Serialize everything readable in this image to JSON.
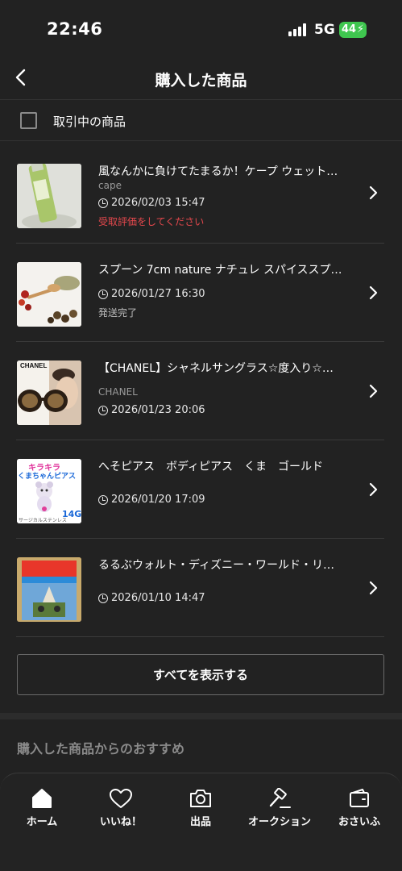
{
  "status": {
    "time": "22:46",
    "network": "5G",
    "battery": "44"
  },
  "header": {
    "title": "購入した商品"
  },
  "filter": {
    "label": "取引中の商品"
  },
  "items": [
    {
      "title": "風なんかに負けてたまるか！ケープ ウェット…",
      "brand": "cape",
      "date": "2026/02/03 15:47",
      "status": "受取評価をしてください",
      "status_color": "#e5484d"
    },
    {
      "title": "スプーン 7cm nature ナチュレ スパイススプ…",
      "brand": "",
      "date": "2026/01/27 16:30",
      "status": "発送完了",
      "status_color": "#bdbdbd"
    },
    {
      "title": "【CHANEL】シャネルサングラス☆度入り☆…",
      "brand": "CHANEL",
      "date": "2026/01/23 20:06",
      "status": "",
      "status_color": ""
    },
    {
      "title": "へそピアス　ボディピアス　くま　ゴールド",
      "brand": "",
      "date": "2026/01/20 17:09",
      "status": "",
      "status_color": ""
    },
    {
      "title": "るるぶウォルト・ディズニー・ワールド・リ…",
      "brand": "",
      "date": "2026/01/10 14:47",
      "status": "",
      "status_color": ""
    }
  ],
  "thumb_text": {
    "chanel": "CHANEL",
    "piercing_top": "キラキラ",
    "piercing_mid": "くまちゃんピアス",
    "piercing_size": "14G",
    "piercing_bottom": "サージカルステンレス"
  },
  "show_all": "すべてを表示する",
  "recommend_title": "購入した商品からのおすすめ",
  "tabs": [
    {
      "label": "ホーム",
      "icon": "home-icon"
    },
    {
      "label": "いいね！",
      "icon": "heart-icon"
    },
    {
      "label": "出品",
      "icon": "camera-icon"
    },
    {
      "label": "オークション",
      "icon": "gavel-icon"
    },
    {
      "label": "おさいふ",
      "icon": "wallet-icon"
    }
  ]
}
